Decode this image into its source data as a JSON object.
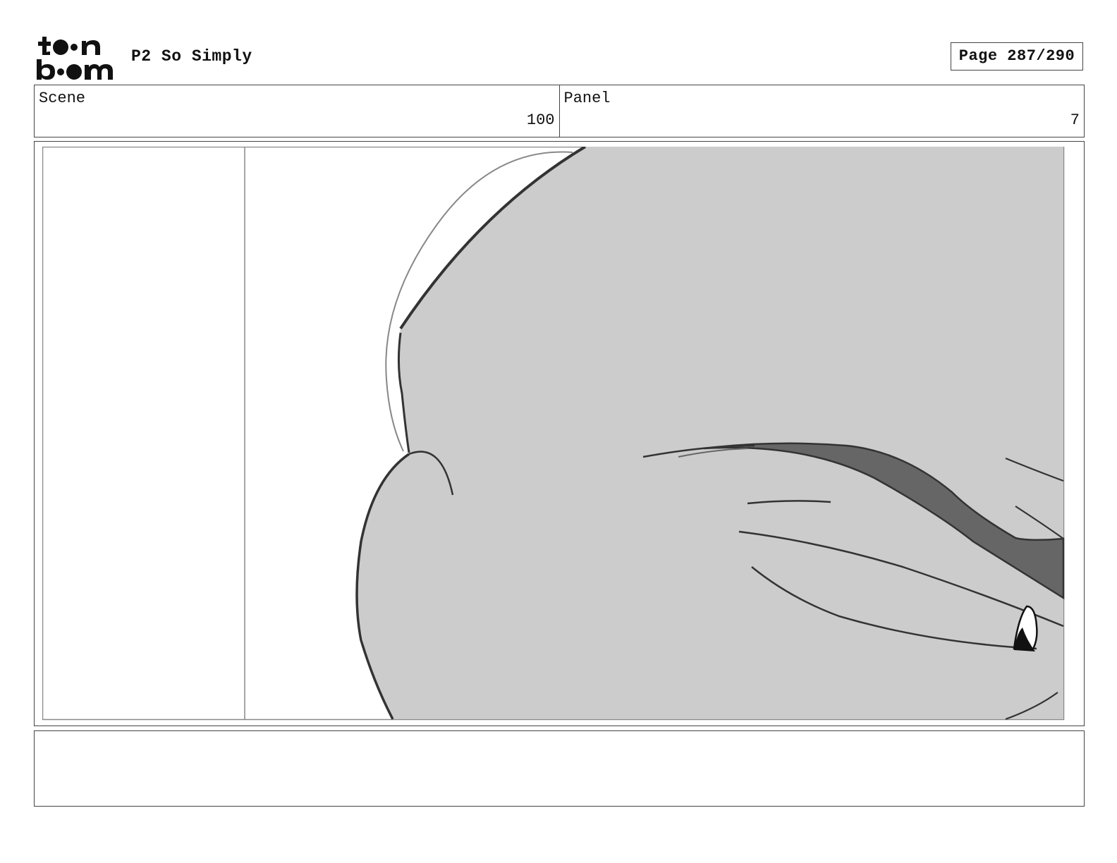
{
  "header": {
    "logo": "toon boom",
    "project_title": "P2 So Simply",
    "page_label": "Page 287/290"
  },
  "info": {
    "scene_label": "Scene",
    "scene_value": "100",
    "panel_label": "Panel",
    "panel_value": "7"
  },
  "notes": {
    "text": ""
  },
  "colors": {
    "skin_fill": "#cccccc",
    "dark_fill": "#666666",
    "line": "#333333",
    "border": "#444444"
  }
}
